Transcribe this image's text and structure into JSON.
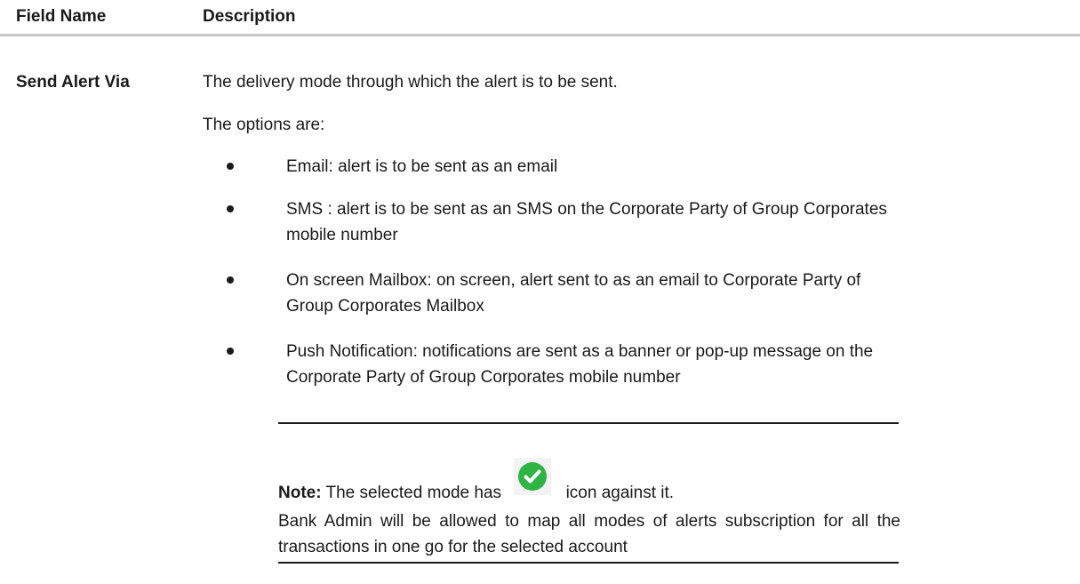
{
  "table": {
    "headers": {
      "field_name": "Field Name",
      "description": "Description"
    },
    "row": {
      "field": "Send Alert Via",
      "description": "The delivery mode through which the alert is to be sent.",
      "options_intro": "The options are:",
      "options": [
        "Email: alert is to be sent as an email",
        "SMS : alert is to be sent as an SMS on the Corporate Party of Group Corporates mobile number",
        "On screen Mailbox: on screen, alert sent to as an email to Corporate Party of Group Corporates Mailbox",
        "Push Notification: notifications are sent as a banner or pop-up message on the Corporate Party of Group Corporates mobile number"
      ],
      "note": {
        "label": "Note:",
        "text_before_icon": "The selected mode has",
        "icon": "green-check-circle",
        "text_after_icon": "icon against it.",
        "paragraph": "Bank Admin will be allowed to map all modes of alerts subscription for all the transactions in one go for the selected account"
      }
    }
  },
  "colors": {
    "header_rule": "#c6c6c6",
    "check_icon": "#2fb344",
    "text": "#1a1a1a"
  }
}
